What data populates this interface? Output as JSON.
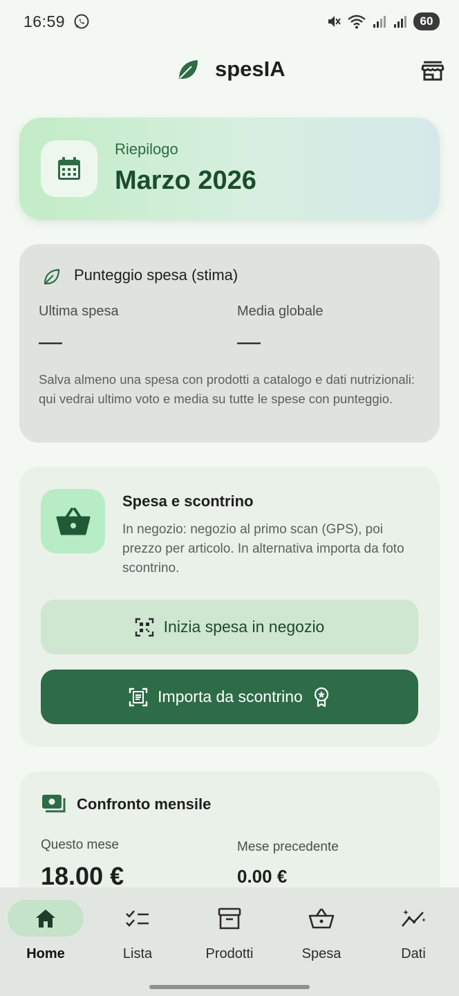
{
  "status_bar": {
    "time": "16:59",
    "battery": "60",
    "icons": [
      "whatsapp-icon",
      "mute-icon",
      "wifi-icon",
      "signal-icon",
      "signal-icon"
    ]
  },
  "header": {
    "title": "spesIA",
    "logo_icon": "leaf-icon",
    "action_icon": "store-icon"
  },
  "summary": {
    "label": "Riepilogo",
    "month": "Marzo 2026",
    "icon": "calendar-icon"
  },
  "score": {
    "title": "Punteggio spesa (stima)",
    "last_label": "Ultima spesa",
    "last_value": "—",
    "avg_label": "Media globale",
    "avg_value": "—",
    "description": "Salva almeno una spesa con prodotti a catalogo e dati nutrizionali: qui vedrai ultimo voto e media su tutte le spese con punteggio."
  },
  "shopping": {
    "title": "Spesa e scontrino",
    "description": "In negozio: negozio al primo scan (GPS), poi prezzo per articolo. In alternativa importa da foto scontrino.",
    "start_button": "Inizia spesa in negozio",
    "import_button": "Importa da scontrino"
  },
  "monthly": {
    "title": "Confronto mensile",
    "current_label": "Questo mese",
    "current_value": "18.00 €",
    "previous_label": "Mese precedente",
    "previous_value": "0.00 €"
  },
  "nav": {
    "items": [
      {
        "label": "Home",
        "icon": "home-icon",
        "active": true
      },
      {
        "label": "Lista",
        "icon": "checklist-icon",
        "active": false
      },
      {
        "label": "Prodotti",
        "icon": "archive-icon",
        "active": false
      },
      {
        "label": "Spesa",
        "icon": "basket-icon",
        "active": false
      },
      {
        "label": "Dati",
        "icon": "analytics-icon",
        "active": false
      }
    ]
  },
  "colors": {
    "primary": "#2e6b47",
    "primary_container": "#cfe6d0",
    "background": "#f3f8f2"
  }
}
